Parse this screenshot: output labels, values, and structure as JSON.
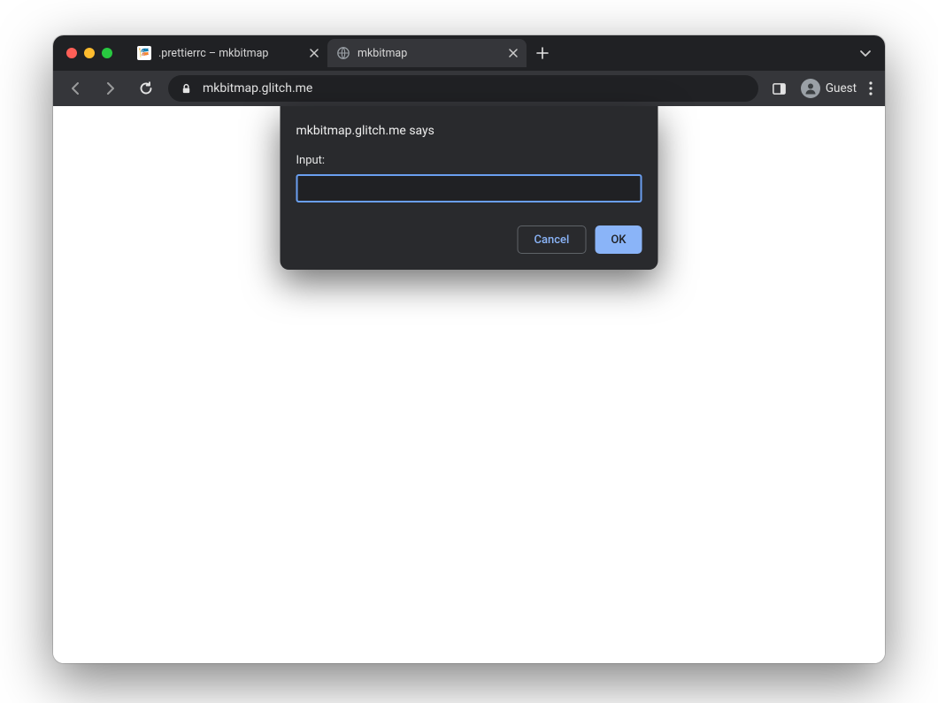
{
  "tabs": [
    {
      "label": ".prettierrc – mkbitmap"
    },
    {
      "label": "mkbitmap"
    }
  ],
  "omnibox": {
    "url": "mkbitmap.glitch.me"
  },
  "profile": {
    "label": "Guest"
  },
  "dialog": {
    "title": "mkbitmap.glitch.me says",
    "label": "Input:",
    "value": "",
    "cancel": "Cancel",
    "ok": "OK"
  }
}
